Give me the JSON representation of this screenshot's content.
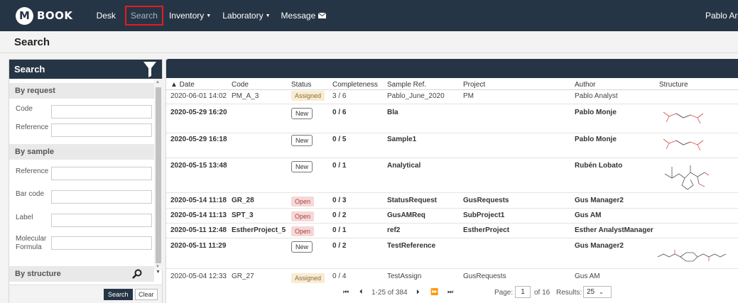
{
  "nav": {
    "logo_letter": "M",
    "logo_text": "BOOK",
    "items": [
      "Desk",
      "Search",
      "Inventory",
      "Laboratory",
      "Message"
    ],
    "user": "Pablo Analy"
  },
  "page": {
    "title": "Search"
  },
  "left": {
    "header": "Search",
    "sections": {
      "by_request": "By request",
      "by_sample": "By sample",
      "by_structure": "By structure"
    },
    "request_fields": [
      "Code",
      "Reference"
    ],
    "sample_fields": [
      "Reference",
      "Bar code",
      "Label",
      "Molecular Formula"
    ],
    "search_button": "Search",
    "clear_button": "Clear"
  },
  "table": {
    "headers": [
      "▲ Date",
      "Code",
      "Status",
      "Completeness",
      "Sample Ref.",
      "Project",
      "Author",
      "Structure"
    ],
    "rows": [
      {
        "date": "2020-06-01 14:02",
        "code": "PM_A_3",
        "status": "Assigned",
        "completeness": "3 / 6",
        "sample_ref": "Pablo_June_2020",
        "project": "PM",
        "author": "Pablo Analyst"
      },
      {
        "date": "2020-05-29 16:20",
        "code": "",
        "status": "New",
        "completeness": "0 / 6",
        "sample_ref": "Bla",
        "project": "",
        "author": "Pablo Monje"
      },
      {
        "date": "2020-05-29 16:18",
        "code": "",
        "status": "New",
        "completeness": "0 / 5",
        "sample_ref": "Sample1",
        "project": "",
        "author": "Pablo Monje"
      },
      {
        "date": "2020-05-15 13:48",
        "code": "",
        "status": "New",
        "completeness": "0 / 1",
        "sample_ref": "Analytical",
        "project": "",
        "author": "Rubén Lobato"
      },
      {
        "date": "2020-05-14 11:18",
        "code": "GR_28",
        "status": "Open",
        "completeness": "0 / 3",
        "sample_ref": "StatusRequest",
        "project": "GusRequests",
        "author": "Gus Manager2"
      },
      {
        "date": "2020-05-14 11:13",
        "code": "SPT_3",
        "status": "Open",
        "completeness": "0 / 2",
        "sample_ref": "GusAMReq",
        "project": "SubProject1",
        "author": "Gus AM"
      },
      {
        "date": "2020-05-11 12:48",
        "code": "EstherProject_5",
        "status": "Open",
        "completeness": "0 / 1",
        "sample_ref": "ref2",
        "project": "EstherProject",
        "author": "Esther AnalystManager"
      },
      {
        "date": "2020-05-11 11:29",
        "code": "",
        "status": "New",
        "completeness": "0 / 2",
        "sample_ref": "TestReference",
        "project": "",
        "author": "Gus Manager2"
      },
      {
        "date": "2020-05-04 12:33",
        "code": "GR_27",
        "status": "Assigned",
        "completeness": "0 / 4",
        "sample_ref": "TestAssign",
        "project": "GusRequests",
        "author": "Gus AM"
      }
    ]
  },
  "pager": {
    "range": "1-25 of 384",
    "page_label": "Page:",
    "page_value": "1",
    "of_label": "of 16",
    "results_label": "Results:",
    "results_value": "25"
  },
  "colors": {
    "nav_bg": "#263545",
    "highlight": "#e51b1b",
    "open_bg": "#f6d7d7",
    "assigned_bg": "#f8ecd2"
  }
}
